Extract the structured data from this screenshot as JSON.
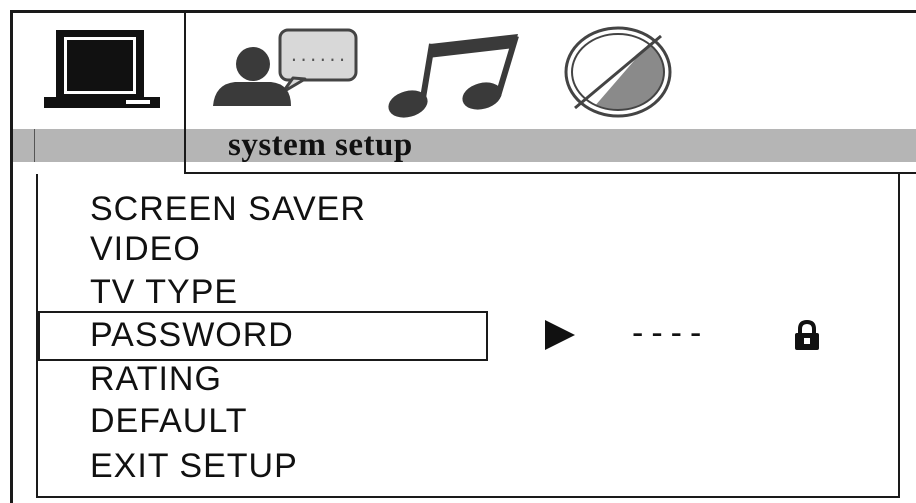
{
  "tabs": [
    {
      "name": "system",
      "icon": "tv-monitor-icon",
      "selected": true
    },
    {
      "name": "language",
      "icon": "person-speech-bubble-icon",
      "selected": false
    },
    {
      "name": "audio",
      "icon": "music-note-icon",
      "selected": false
    },
    {
      "name": "video",
      "icon": "half-circle-contrast-icon",
      "selected": false
    }
  ],
  "header": {
    "title": "system setup"
  },
  "menu": {
    "items": [
      {
        "label": "SCREEN SAVER"
      },
      {
        "label": "VIDEO"
      },
      {
        "label": "TV TYPE"
      },
      {
        "label": "PASSWORD",
        "selected": true
      },
      {
        "label": "RATING"
      },
      {
        "label": "DEFAULT"
      },
      {
        "label": "EXIT SETUP"
      }
    ]
  },
  "password": {
    "value": "----",
    "arrow_icon": "right-triangle-icon",
    "lock_icon": "lock-icon"
  },
  "colors": {
    "title_band": "#b5b5b5",
    "ink": "#111111",
    "background": "#ffffff"
  }
}
